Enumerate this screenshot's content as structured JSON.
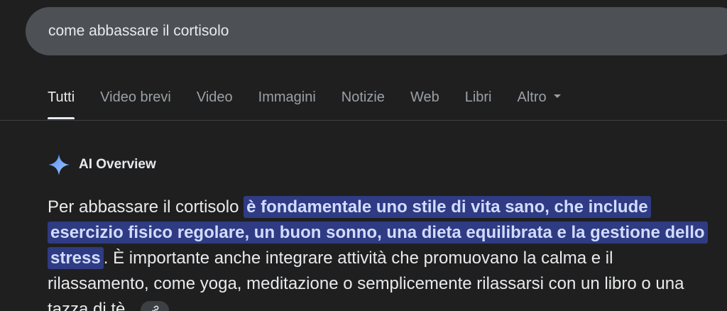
{
  "search": {
    "query": "come abbassare il cortisolo"
  },
  "tabs": [
    {
      "label": "Tutti"
    },
    {
      "label": "Video brevi"
    },
    {
      "label": "Video"
    },
    {
      "label": "Immagini"
    },
    {
      "label": "Notizie"
    },
    {
      "label": "Web"
    },
    {
      "label": "Libri"
    },
    {
      "label": "Altro"
    }
  ],
  "ai_overview": {
    "title": "AI Overview",
    "text_before": "Per abbassare il cortisolo",
    "highlighted": "è fondamentale uno stile di vita sano, che include esercizio fisico regolare, un buon sonno, una dieta equilibrata e la gestione dello stress",
    "text_after": ". È importante anche integrare attività che promuovano la calma e il rilassamento, come yoga, meditazione o semplicemente rilassarsi con un libro o una tazza di tè."
  },
  "colors": {
    "background": "#1f1f1f",
    "search_box": "#4d5156",
    "highlight": "#2f3b83",
    "gemini_blue": "#8ab4f8"
  },
  "icons": {
    "ai_overview": "gemini-sparkle-icon",
    "more_tabs": "caret-down-icon",
    "source_link": "link-icon"
  }
}
